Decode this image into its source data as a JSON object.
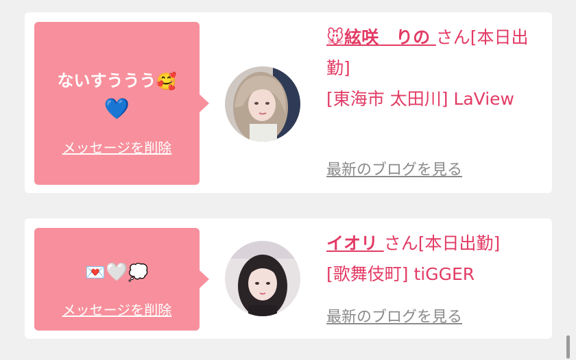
{
  "messages": [
    {
      "text": "ないすううう",
      "emoji_after_text": "🥰",
      "emoji_line2": "💙",
      "delete_label": "メッセージを削除",
      "cast_name": "🐭絃咲　りの",
      "honorific": "さん[本日出勤]",
      "shop": "[東海市 太田川] LaView",
      "blog_label": "最新のブログを見る"
    },
    {
      "text": "",
      "emoji_line": [
        "💌",
        "🤍",
        "💭"
      ],
      "delete_label": "メッセージを削除",
      "cast_name": "イオリ",
      "honorific": "さん[本日出勤]",
      "shop": "[歌舞伎町] tiGGER",
      "blog_label": "最新のブログを見る"
    }
  ],
  "colors": {
    "bubble": "#f7909c",
    "accent_text": "#e23a64",
    "muted_link": "#8a8a8a",
    "background": "#f0f0f0",
    "card": "#ffffff"
  },
  "icons": {
    "message_1": [
      "smiling-face-with-hearts-icon",
      "blue-heart-icon"
    ],
    "message_2": [
      "love-letter-icon",
      "white-heart-icon",
      "thought-balloon-icon"
    ],
    "name_prefix_1": "mouse-face-icon"
  }
}
